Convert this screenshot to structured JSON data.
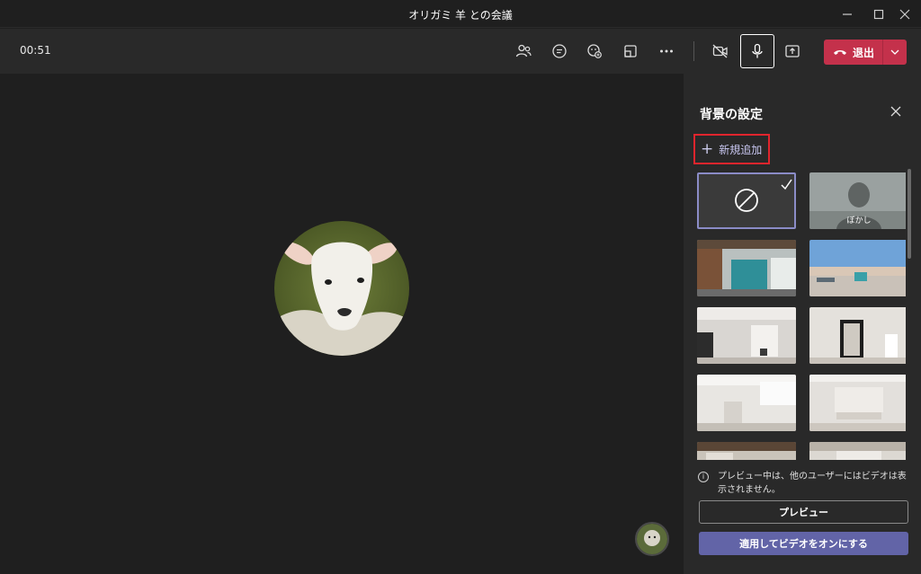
{
  "window": {
    "title": "オリガミ 羊 との会議"
  },
  "toolbar": {
    "timer": "00:51",
    "icons": [
      "participants-icon",
      "chat-icon",
      "reactions-icon",
      "breakout-icon",
      "more-icon",
      "video-off-icon",
      "mic-icon",
      "share-icon"
    ],
    "leave_label": "退出"
  },
  "panel": {
    "title": "背景の設定",
    "add_new_label": "新規追加",
    "backgrounds": [
      {
        "label": "",
        "kind": "none",
        "selected": true
      },
      {
        "label": "ぼかし",
        "kind": "blur",
        "selected": false
      },
      {
        "label": "",
        "kind": "office",
        "selected": false
      },
      {
        "label": "",
        "kind": "outdoor",
        "selected": false
      },
      {
        "label": "",
        "kind": "room-window",
        "selected": false
      },
      {
        "label": "",
        "kind": "room-mirror",
        "selected": false
      },
      {
        "label": "",
        "kind": "loft",
        "selected": false
      },
      {
        "label": "",
        "kind": "bright-room",
        "selected": false
      },
      {
        "label": "",
        "kind": "office-2",
        "selected": false
      },
      {
        "label": "",
        "kind": "room-3",
        "selected": false
      }
    ],
    "info_text": "プレビュー中は、他のユーザーにはビデオは表示されません。",
    "preview_label": "プレビュー",
    "apply_label": "適用してビデオをオンにする"
  },
  "colors": {
    "accent": "#6264a7",
    "leave": "#c4314b",
    "highlight": "#e0252d"
  }
}
